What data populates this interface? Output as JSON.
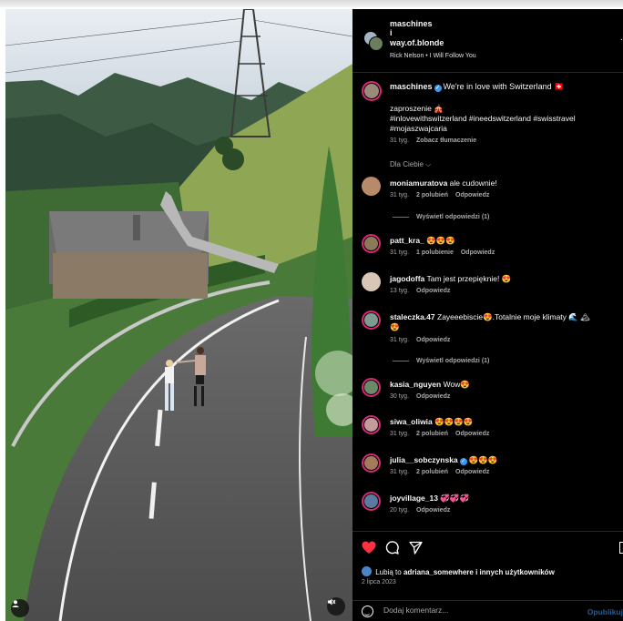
{
  "header": {
    "user1": "maschines",
    "separator": "i",
    "user2": "way.of.blonde",
    "song": "Rick Nelson • I Will Follow You",
    "more_icon": "more-dots-icon"
  },
  "caption": {
    "user": "maschines",
    "text": "We're in love with Switzerland 🇨🇭",
    "line2": "zaproszenie 🎪",
    "hashtags1": "#inlovewithswitzerland #ineedswitzerland #swisstravel",
    "hashtags2": "#mojaszwajcaria",
    "time": "31 tyg.",
    "translate": "Zobacz tłumaczenie"
  },
  "for_you": "Dla Ciebie ⌵",
  "comments": [
    {
      "user": "moniamuratova",
      "text": "ale cudownie!",
      "time": "31 tyg.",
      "likes": "2 polubień",
      "reply": "Odpowiedz",
      "replies": "Wyświetl odpowiedzi (1)",
      "color": "#b98a6a"
    },
    {
      "user": "patt_kra_",
      "text": "😍😍😍",
      "time": "31 tyg.",
      "likes": "1 polubienie",
      "reply": "Odpowiedz",
      "color": "#8a7a5a"
    },
    {
      "user": "jagodoffa",
      "text": "Tam jest przepięknie! 😍",
      "time": "13 tyg.",
      "reply": "Odpowiedz",
      "color": "#d8c7b6"
    },
    {
      "user": "staleczka.47",
      "text": "Zayeeebiscie😍.Totalnie moje klimaty 🌊 🏔",
      "text2": "😍",
      "time": "31 tyg.",
      "reply": "Odpowiedz",
      "replies": "Wyświetl odpowiedzi (1)",
      "color": "#7d9b8f"
    },
    {
      "user": "kasia_nguyen",
      "text": "Wow😍",
      "time": "30 tyg.",
      "reply": "Odpowiedz",
      "color": "#6a8a6a"
    },
    {
      "user": "siwa_oliwia",
      "text": "😍😍😍😍",
      "time": "31 tyg.",
      "likes": "2 polubień",
      "reply": "Odpowiedz",
      "color": "#c49a9a"
    },
    {
      "user": "julia__sobczynska",
      "text": "😍😍😍",
      "time": "31 tyg.",
      "likes": "2 polubień",
      "reply": "Odpowiedz",
      "color": "#a57a5a"
    },
    {
      "user": "joyvillage_13",
      "text": "💞💞💞",
      "time": "20 tyg.",
      "reply": "Odpowiedz",
      "color": "#5a7aa0"
    }
  ],
  "likes": {
    "prefix": "Lubią to",
    "user": "adriana_somewhere",
    "suffix": "i innych użytkowników"
  },
  "date": "2 lipca 2023",
  "add_comment": {
    "placeholder": "Dodaj komentarz...",
    "publish": "Opublikuj"
  },
  "colors": {
    "heart": "#ff3040",
    "verified": "#3897f0",
    "story_ring": "#d62976"
  }
}
